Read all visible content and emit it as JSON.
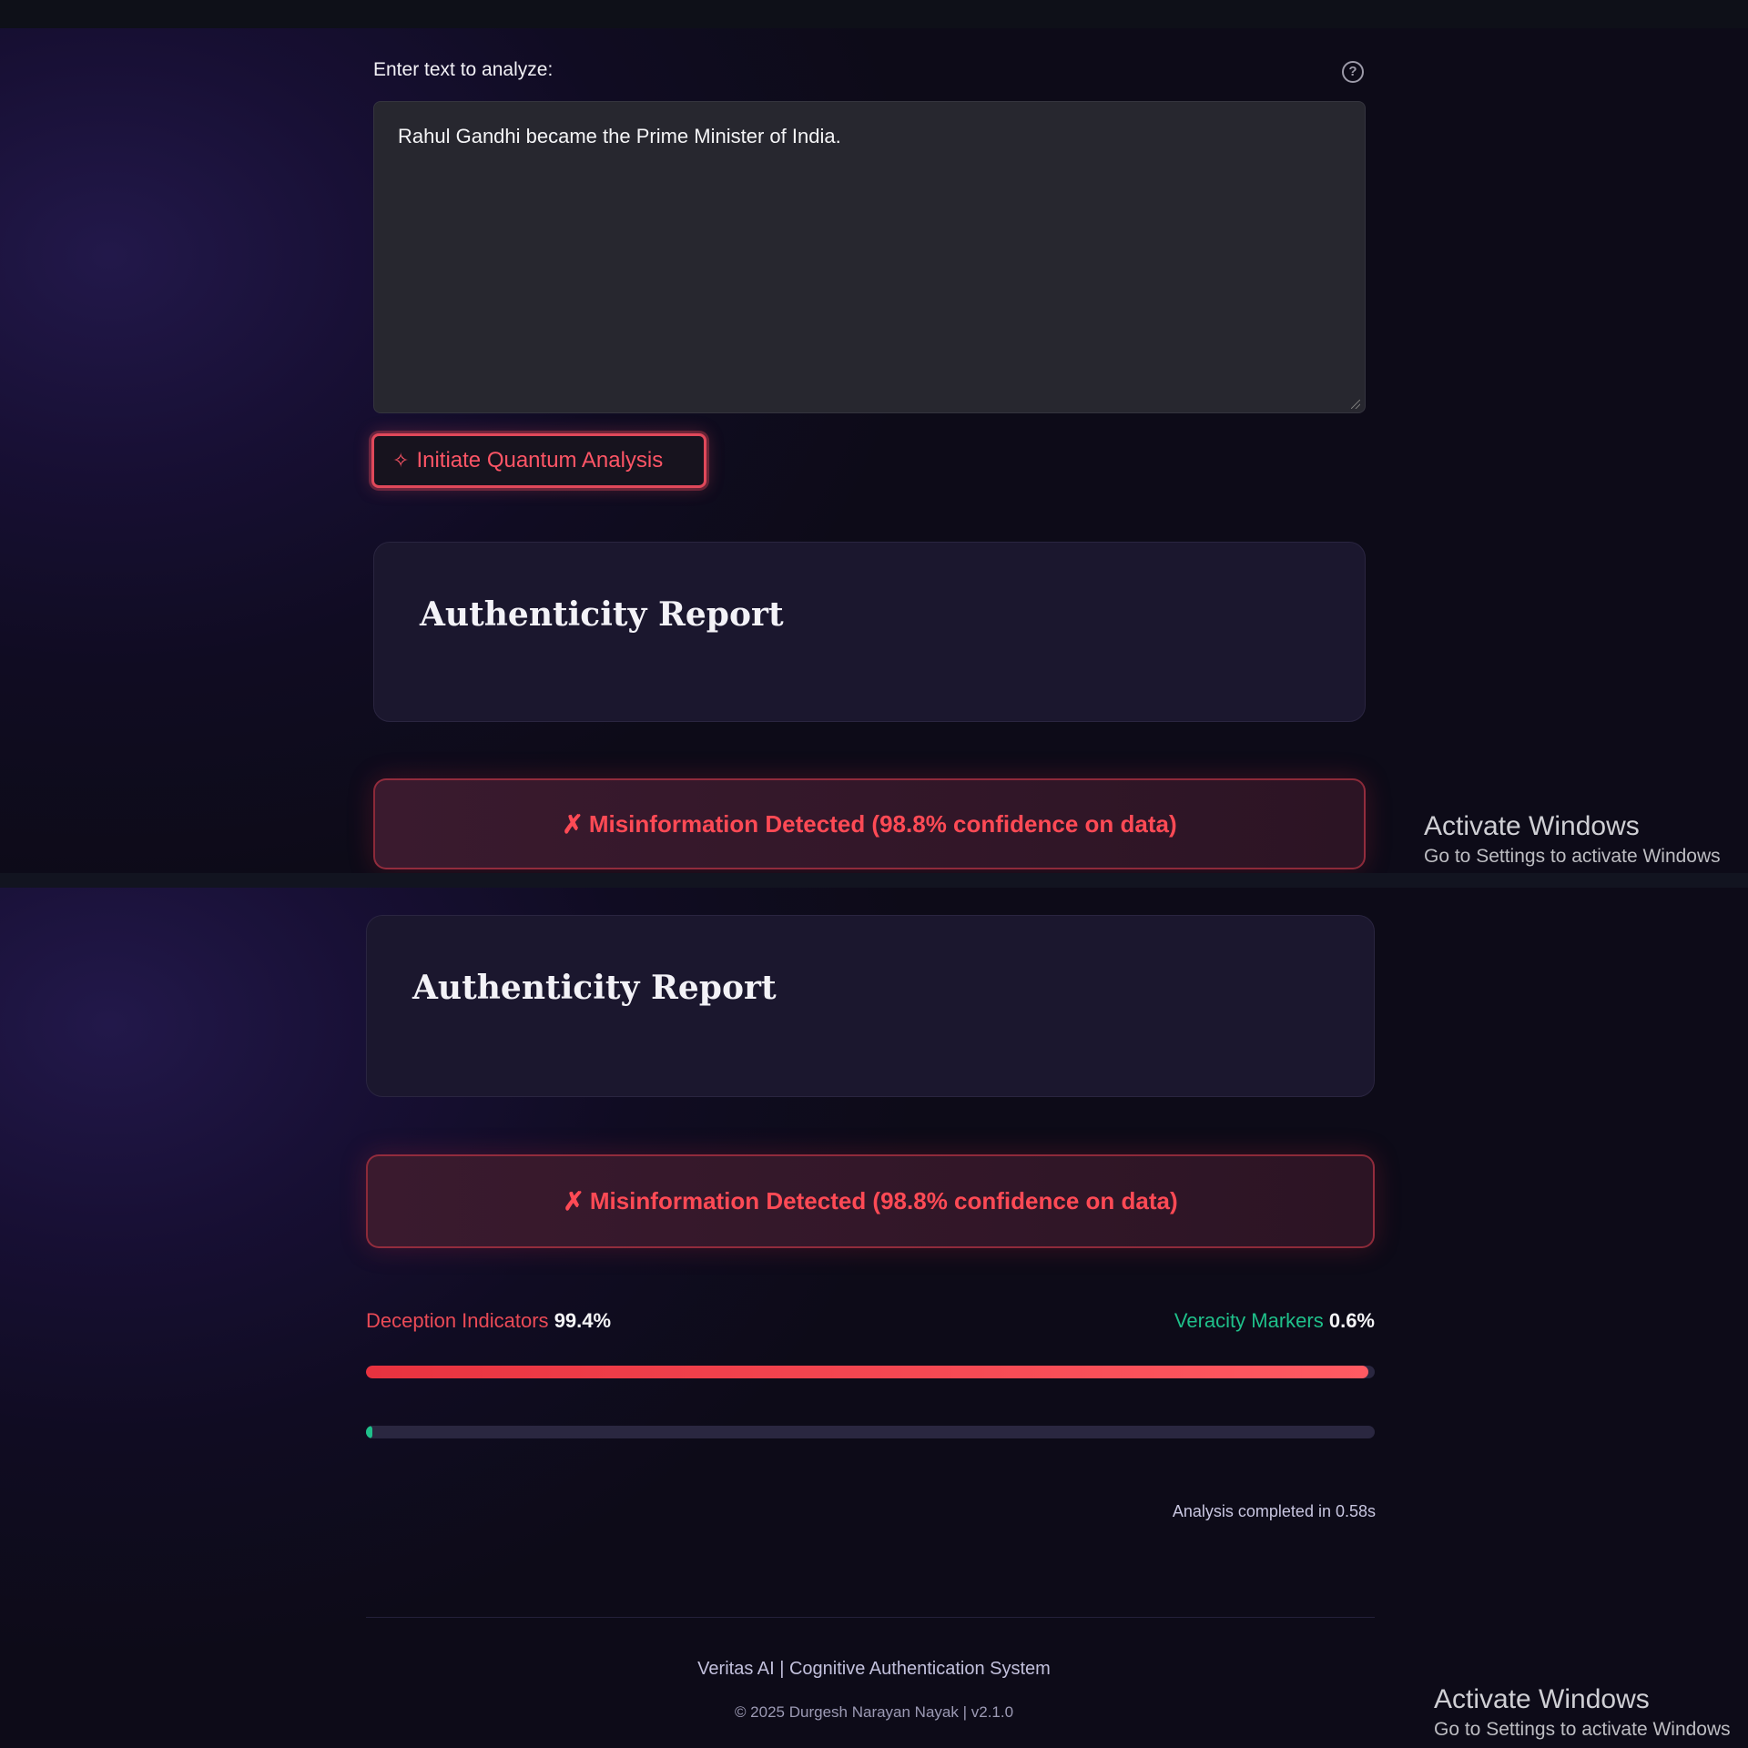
{
  "input": {
    "label": "Enter text to analyze:",
    "help_icon": "question-circle-icon",
    "value": "Rahul Gandhi became the Prime Minister of India."
  },
  "analyze_button": {
    "icon": "sparkle-icon",
    "icon_glyph": "✧",
    "label": "Initiate Quantum Analysis"
  },
  "report": {
    "title": "Authenticity Report"
  },
  "result": {
    "icon_glyph": "✗",
    "message": "Misinformation Detected (98.8% confidence on data)"
  },
  "indicators": {
    "deception_label": "Deception Indicators",
    "deception_value": "99.4%",
    "deception_fraction": 0.994,
    "veracity_label": "Veracity Markers",
    "veracity_value": "0.6%",
    "veracity_fraction": 0.006
  },
  "completed_text": "Analysis completed in 0.58s",
  "footer": {
    "line1": "Veritas AI | Cognitive Authentication System",
    "line2": "© 2025 Durgesh Narayan Nayak | v2.1.0"
  },
  "watermark": {
    "title": "Activate Windows",
    "subtitle": "Go to Settings to activate Windows"
  },
  "colors": {
    "accent_red": "#ea4a56",
    "accent_green": "#1fc08a",
    "background": "#170f33"
  }
}
